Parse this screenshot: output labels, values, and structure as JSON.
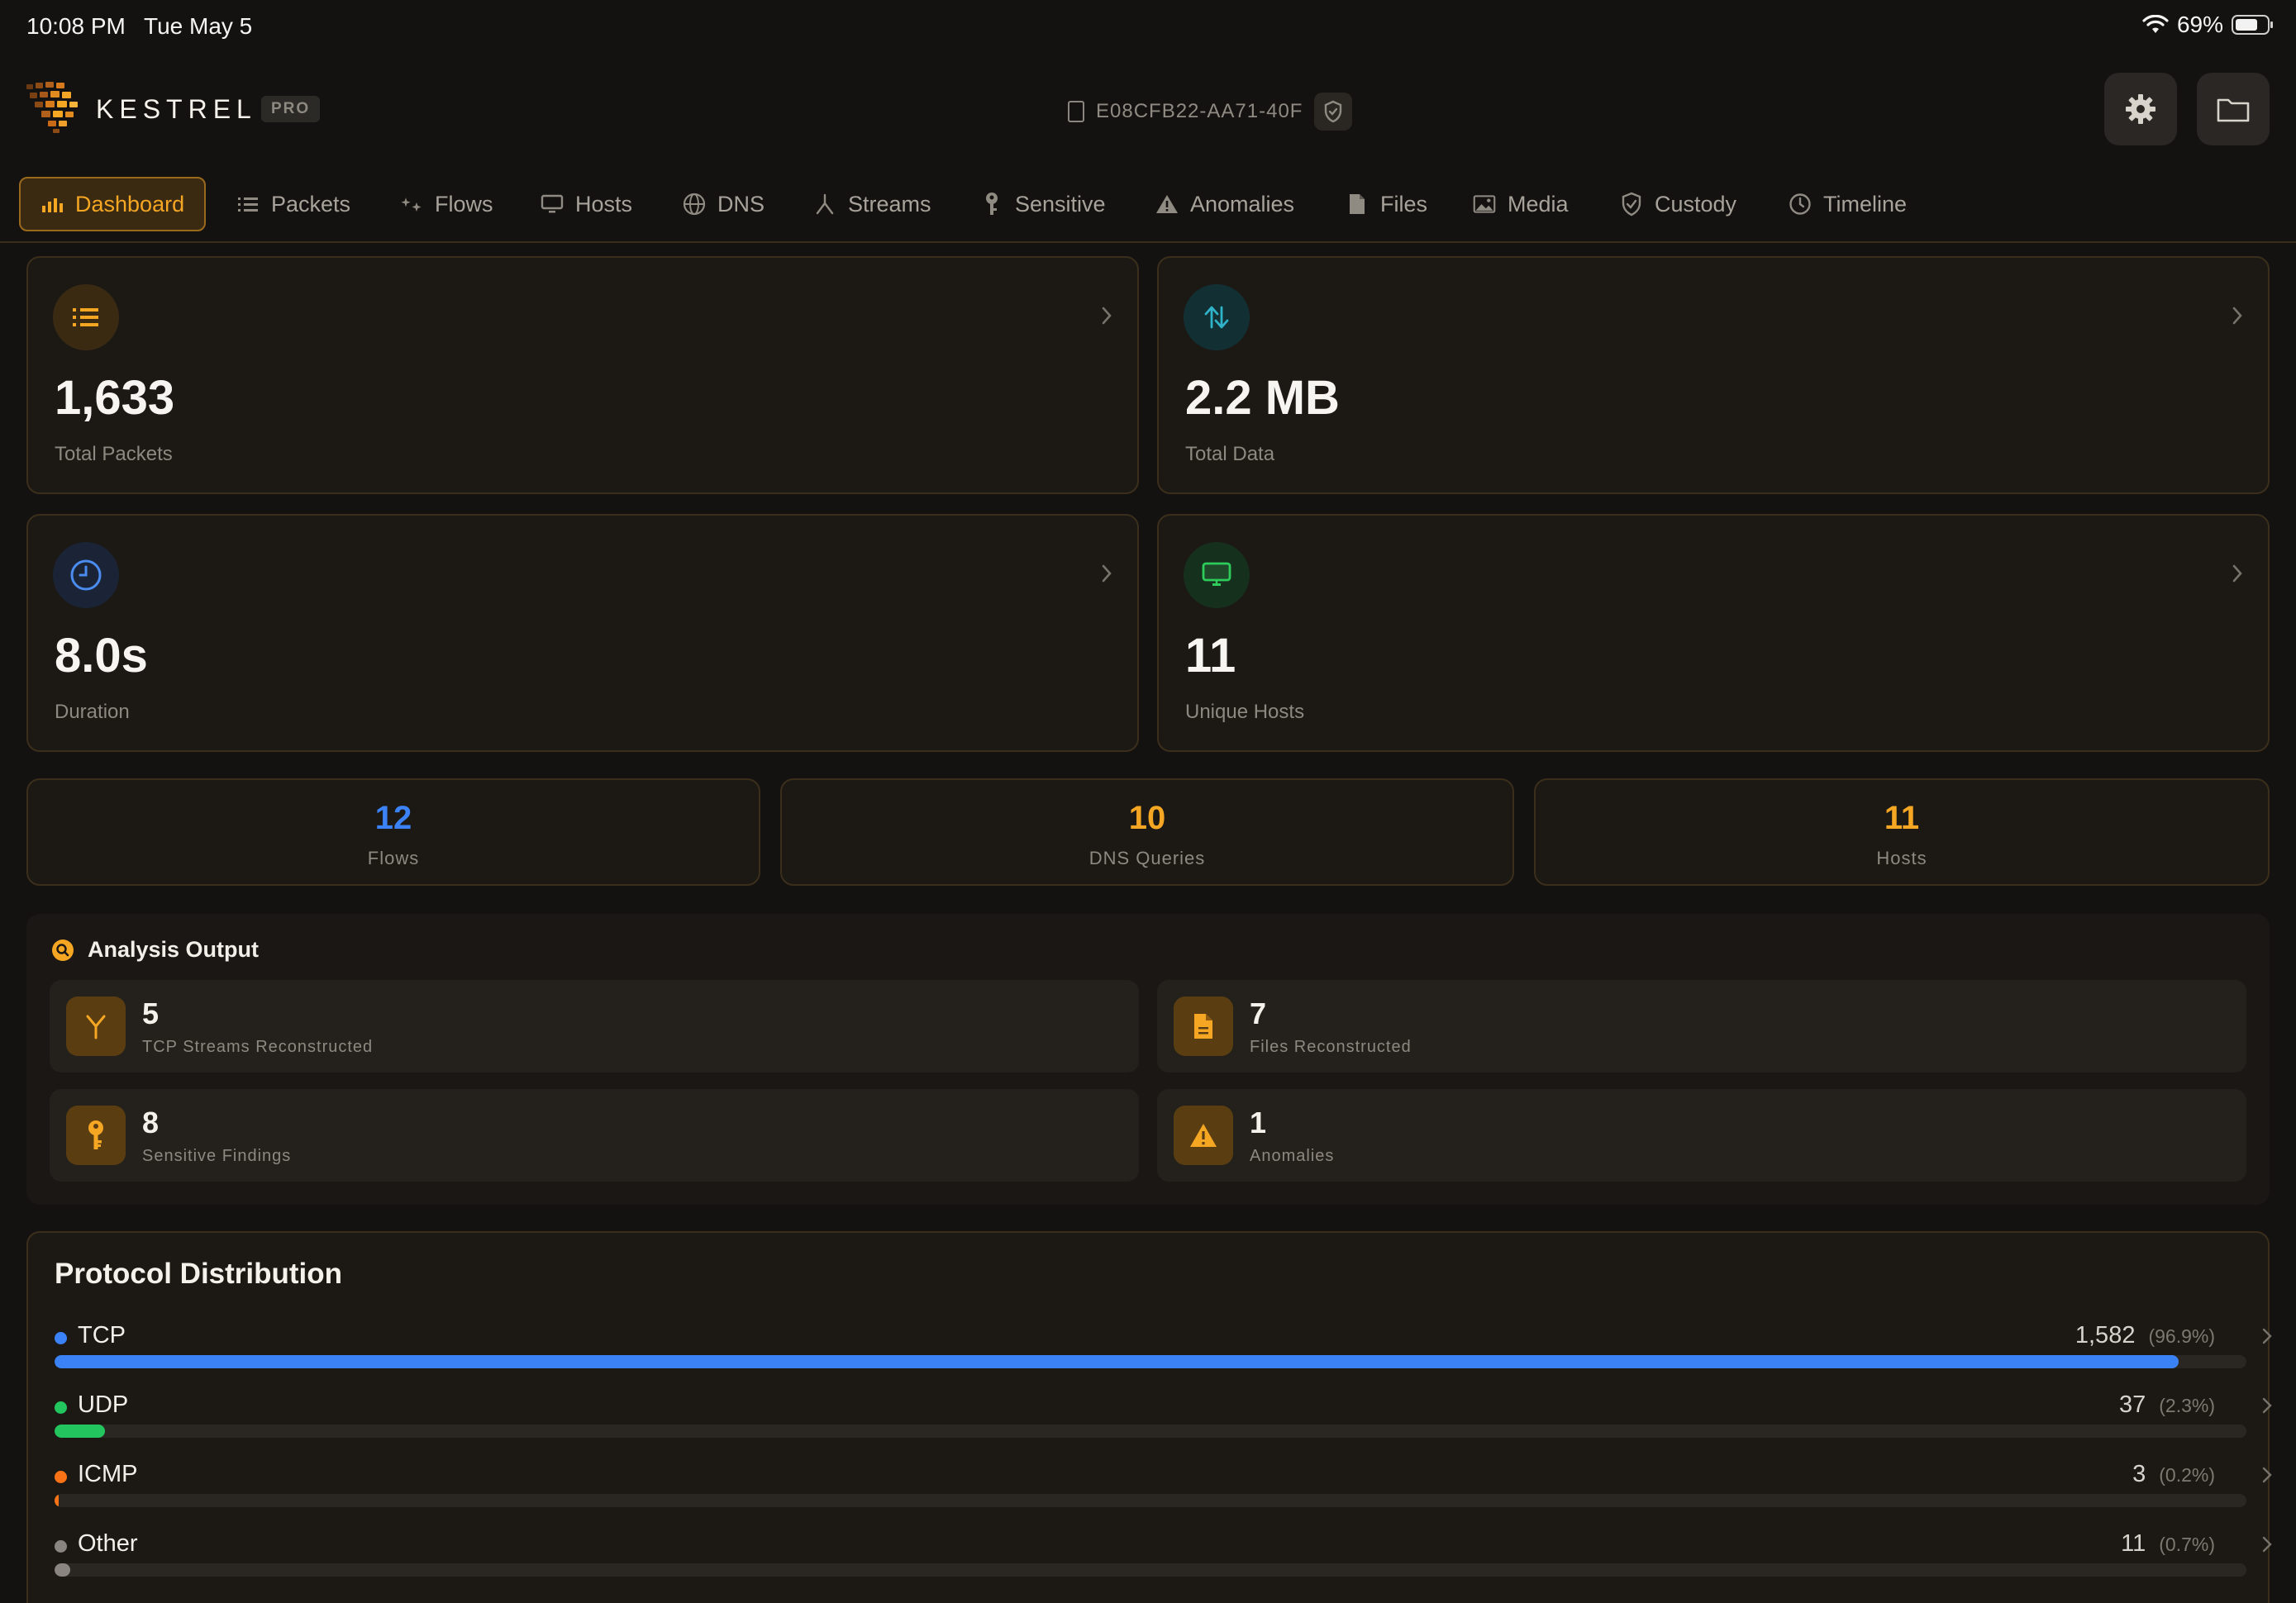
{
  "status_bar": {
    "time": "10:08 PM",
    "date": "Tue May 5",
    "battery": "69%",
    "battery_level": 0.69
  },
  "header": {
    "brand": "KESTREL",
    "badge": "PRO",
    "session_id": "E08CFB22-AA71-40F",
    "icons": [
      "session-doc-icon",
      "shield-check-icon",
      "gear-icon",
      "folder-icon"
    ]
  },
  "tabs": [
    {
      "label": "Dashboard",
      "icon": "bar-chart-icon",
      "active": true
    },
    {
      "label": "Packets",
      "icon": "list-icon"
    },
    {
      "label": "Flows",
      "icon": "sparkle-icon"
    },
    {
      "label": "Hosts",
      "icon": "monitor-icon"
    },
    {
      "label": "DNS",
      "icon": "globe-icon"
    },
    {
      "label": "Streams",
      "icon": "branch-icon"
    },
    {
      "label": "Sensitive",
      "icon": "key-icon"
    },
    {
      "label": "Anomalies",
      "icon": "warning-icon"
    },
    {
      "label": "Files",
      "icon": "file-icon"
    },
    {
      "label": "Media",
      "icon": "photo-icon"
    },
    {
      "label": "Custody",
      "icon": "shield-icon"
    },
    {
      "label": "Timeline",
      "icon": "clock-icon"
    }
  ],
  "stats": [
    {
      "value": "1,633",
      "label": "Total Packets",
      "icon": "list-icon",
      "color": "#f5a623"
    },
    {
      "value": "2.2 MB",
      "label": "Total Data",
      "icon": "arrows-up-down-icon",
      "color": "#2fb3c9"
    },
    {
      "value": "8.0s",
      "label": "Duration",
      "icon": "clock-icon",
      "color": "#4a8cf0"
    },
    {
      "value": "11",
      "label": "Unique Hosts",
      "icon": "monitor-icon",
      "color": "#2ecc5a"
    }
  ],
  "summary": [
    {
      "value": "12",
      "label": "Flows",
      "color": "#3b82f6"
    },
    {
      "value": "10",
      "label": "DNS Queries",
      "color": "#f5a623"
    },
    {
      "value": "11",
      "label": "Hosts",
      "color": "#f5a623"
    }
  ],
  "analysis": {
    "title": "Analysis Output",
    "items": [
      {
        "value": "5",
        "label": "TCP Streams Reconstructed",
        "icon": "branch-icon"
      },
      {
        "value": "7",
        "label": "Files Reconstructed",
        "icon": "file-icon"
      },
      {
        "value": "8",
        "label": "Sensitive Findings",
        "icon": "key-icon"
      },
      {
        "value": "1",
        "label": "Anomalies",
        "icon": "warning-icon"
      }
    ]
  },
  "protocols": {
    "title": "Protocol Distribution",
    "rows": [
      {
        "name": "TCP",
        "count": "1,582",
        "pct": "(96.9%)",
        "fraction": 0.969,
        "color": "#3b82f6"
      },
      {
        "name": "UDP",
        "count": "37",
        "pct": "(2.3%)",
        "fraction": 0.023,
        "color": "#22c55e"
      },
      {
        "name": "ICMP",
        "count": "3",
        "pct": "(0.2%)",
        "fraction": 0.002,
        "color": "#f97316"
      },
      {
        "name": "Other",
        "count": "11",
        "pct": "(0.7%)",
        "fraction": 0.007,
        "color": "#8a8580"
      }
    ]
  }
}
